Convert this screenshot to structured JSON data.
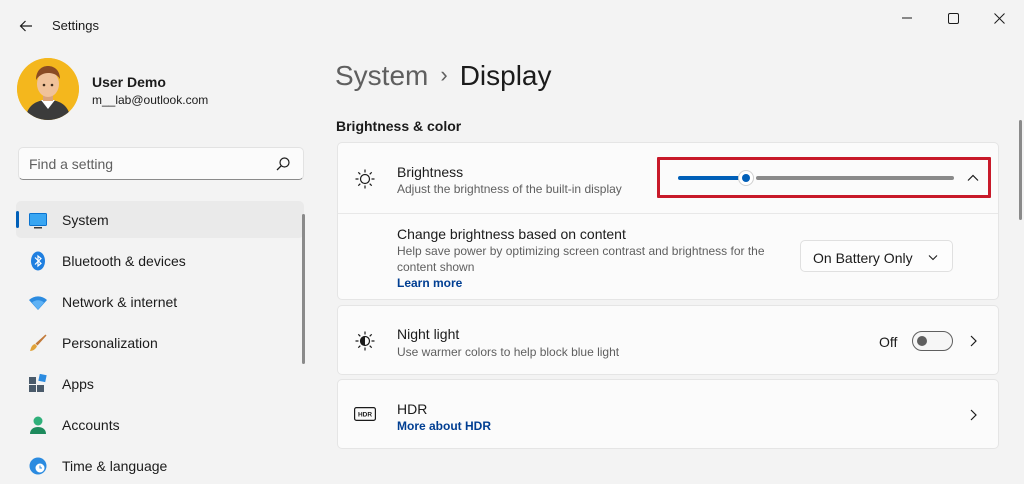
{
  "window": {
    "app_title": "Settings",
    "controls": {
      "minimize": "minimize-icon",
      "maximize": "maximize-icon",
      "close": "close-icon"
    }
  },
  "profile": {
    "name": "User Demo",
    "email": "m__lab@outlook.com"
  },
  "search": {
    "placeholder": "Find a setting",
    "value": ""
  },
  "sidebar": {
    "items": [
      {
        "label": "System",
        "icon": "system-icon",
        "active": true
      },
      {
        "label": "Bluetooth & devices",
        "icon": "bluetooth-icon",
        "active": false
      },
      {
        "label": "Network & internet",
        "icon": "wifi-icon",
        "active": false
      },
      {
        "label": "Personalization",
        "icon": "brush-icon",
        "active": false
      },
      {
        "label": "Apps",
        "icon": "apps-icon",
        "active": false
      },
      {
        "label": "Accounts",
        "icon": "person-icon",
        "active": false
      },
      {
        "label": "Time & language",
        "icon": "clock-globe-icon",
        "active": false
      }
    ]
  },
  "breadcrumb": {
    "parent": "System",
    "separator": "›",
    "current": "Display"
  },
  "section": {
    "title": "Brightness & color"
  },
  "brightness": {
    "title": "Brightness",
    "description": "Adjust the brightness of the built-in display",
    "level_percent": 24,
    "accent_color": "#005fb8",
    "highlight_color": "#c81a2a"
  },
  "content_brightness": {
    "title": "Change brightness based on content",
    "description": "Help save power by optimizing screen contrast and brightness for the content shown",
    "link": "Learn more",
    "dropdown_value": "On Battery Only"
  },
  "night_light": {
    "title": "Night light",
    "description": "Use warmer colors to help block blue light",
    "toggle_state": "Off"
  },
  "hdr": {
    "title": "HDR",
    "link": "More about HDR",
    "icon_text": "HDR"
  }
}
